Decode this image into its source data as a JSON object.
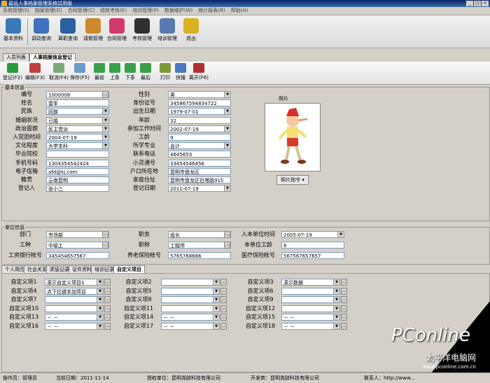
{
  "window": {
    "title": "易远人事档案管理系统试用版"
  },
  "menu": [
    "系统管理(S)",
    "档案管理(D)",
    "合同管理(C)",
    "绩效考核(K)",
    "培训管理(P)",
    "数据维护(W)",
    "统计报表(R)",
    "帮助(H)"
  ],
  "toolbar": [
    {
      "label": "基本资料",
      "icon": "gears-icon",
      "color": "#3a79b8"
    },
    {
      "label": "调动查询",
      "icon": "magnifier-icon",
      "color": "#4070c0"
    },
    {
      "label": "离职查询",
      "icon": "magnifier-icon",
      "color": "#2a5fa0"
    },
    {
      "label": "请假管理",
      "icon": "pen-icon",
      "color": "#cc8a2a"
    },
    {
      "label": "合同管理",
      "icon": "flower-icon",
      "color": "#d03a6a"
    },
    {
      "label": "考核管理",
      "icon": "eraser-icon",
      "color": "#303030"
    },
    {
      "label": "培训管理",
      "icon": "book-icon",
      "color": "#5a7ab0"
    },
    {
      "label": "退出",
      "icon": "key-icon",
      "color": "#d8b020"
    }
  ],
  "tabs_top": [
    {
      "label": "人员列表"
    },
    {
      "label": "人事档案信息登记"
    }
  ],
  "record_toolbar": [
    {
      "label": "登记(F2)",
      "color": "#2a9a3a"
    },
    {
      "label": "编辑(F3)",
      "color": "#c04040"
    },
    {
      "label": "取消(F4)",
      "color": "#7aaa7a"
    },
    {
      "label": "保存(F5)",
      "color": "#6a9aca"
    },
    {
      "label": "最前",
      "color": "#3aa04a"
    },
    {
      "label": "上条",
      "color": "#3aa04a"
    },
    {
      "label": "下条",
      "color": "#3aa04a"
    },
    {
      "label": "最后",
      "color": "#3aa04a"
    },
    {
      "label": "打印",
      "color": "#7a9a3a"
    },
    {
      "label": "快搜",
      "color": "#4a7ac0"
    },
    {
      "label": "离开(F6)",
      "color": "#b03030"
    }
  ],
  "basic": {
    "title": "基本信息",
    "left": [
      {
        "label": "编号",
        "value": "1000008",
        "type": "ellipsis"
      },
      {
        "label": "姓名",
        "value": "雷军",
        "type": "text"
      },
      {
        "label": "民族",
        "value": "回族",
        "type": "dropdown"
      },
      {
        "label": "婚姻状况",
        "value": "已婚",
        "type": "dropdown"
      },
      {
        "label": "政治面貌",
        "value": "民主党派",
        "type": "dropdown"
      },
      {
        "label": "入党团时间",
        "value": "2004-07-19",
        "type": "dropdown"
      },
      {
        "label": "文化程度",
        "value": "大学本科",
        "type": "dropdown"
      },
      {
        "label": "毕业院校",
        "value": "",
        "type": "text"
      },
      {
        "label": "手机号码",
        "value": "1304354542424",
        "type": "text"
      },
      {
        "label": "电子信箱",
        "value": "afd@kj.com",
        "type": "text"
      },
      {
        "label": "籍贯",
        "value": "云南昆明",
        "type": "text"
      },
      {
        "label": "登记人",
        "value": "张小三",
        "type": "text"
      }
    ],
    "right": [
      {
        "label": "性别",
        "value": "男",
        "type": "dropdown"
      },
      {
        "label": "身份证号",
        "value": "345867594834722",
        "type": "text"
      },
      {
        "label": "出生日期",
        "value": "1979-07-01",
        "type": "dropdown"
      },
      {
        "label": "年龄",
        "value": "32",
        "type": "text"
      },
      {
        "label": "参加工作时间",
        "value": "2002-07-19",
        "type": "dropdown"
      },
      {
        "label": "工龄",
        "value": "9",
        "type": "text"
      },
      {
        "label": "所学专业",
        "value": "会计",
        "type": "dropdown"
      },
      {
        "label": "联系电话",
        "value": "4645653",
        "type": "text"
      },
      {
        "label": "小灵通号",
        "value": "33454546456",
        "type": "text"
      },
      {
        "label": "户口所在地",
        "value": "昆明市盘龙区",
        "type": "text"
      },
      {
        "label": "家庭住址",
        "value": "昆明市盘龙区白塔路915",
        "type": "text"
      },
      {
        "label": "登记日期",
        "value": "2011-07-19",
        "type": "dropdown"
      }
    ],
    "photo_label": "照片",
    "photo_button": "照片指令"
  },
  "unit": {
    "title": "单位信息",
    "rows": [
      [
        {
          "label": "部门",
          "value": "市场部",
          "type": "ellipsis"
        },
        {
          "label": "职务",
          "value": "组长",
          "type": "ellipsis"
        },
        {
          "label": "入本单位时间",
          "value": "2005-07-19",
          "type": "dropdown"
        }
      ],
      [
        {
          "label": "工种",
          "value": "中级工",
          "type": "ellipsis"
        },
        {
          "label": "职称",
          "value": "工程师",
          "type": "ellipsis"
        },
        {
          "label": "本单位工龄",
          "value": "6",
          "type": "text"
        }
      ],
      [
        {
          "label": "工资银行帐号",
          "value": "345454657567",
          "type": "text"
        },
        {
          "label": "养老保险帐号",
          "value": "5765768686",
          "type": "text"
        },
        {
          "label": "医疗保险帐号",
          "value": "567567657657",
          "type": "text"
        }
      ]
    ]
  },
  "tabs_bottom": [
    {
      "label": "个人简历"
    },
    {
      "label": "社会关系"
    },
    {
      "label": "奖惩记录"
    },
    {
      "label": "证件资料"
    },
    {
      "label": "培训记录"
    },
    {
      "label": "自定义项目"
    }
  ],
  "custom": [
    [
      {
        "label": "自定义项1",
        "value": "滚示自定义项目1"
      },
      {
        "label": "自定义项2",
        "value": ""
      },
      {
        "label": "自定义项3",
        "value": "滚示数据"
      }
    ],
    [
      {
        "label": "自定义项4",
        "value": "点下拉键本加项目"
      },
      {
        "label": "自定义项5",
        "value": ""
      },
      {
        "label": "自定义项6",
        "value": ""
      }
    ],
    [
      {
        "label": "自定义项7",
        "value": ""
      },
      {
        "label": "自定义项8",
        "value": ""
      },
      {
        "label": "自定义项9",
        "value": ""
      }
    ],
    [
      {
        "label": "自定义项10",
        "value": ""
      },
      {
        "label": "自定义项11",
        "value": ""
      },
      {
        "label": "自定义项12",
        "value": ""
      }
    ],
    [
      {
        "label": "自定义项13",
        "value": "－  －"
      },
      {
        "label": "自定义项14",
        "value": "－  －"
      },
      {
        "label": "自定义项15",
        "value": "－  －"
      }
    ],
    [
      {
        "label": "自定义项16",
        "value": "－  －"
      },
      {
        "label": "自定义项17",
        "value": "－  －"
      },
      {
        "label": "自定义项18",
        "value": "－  －"
      }
    ]
  ],
  "status": [
    {
      "text": "操作员：管理员"
    },
    {
      "text": "当前日期：2011-11-14"
    },
    {
      "text": "授权单位：昆明尧辞科技有限公司"
    },
    {
      "text": "开发商：昆明尧辞科技有限公司"
    },
    {
      "text": "联系人：http://www..."
    }
  ],
  "watermark": {
    "logo": "PConline",
    "sub": "太平洋电脑网",
    "url": "www.pconline.com.cn"
  }
}
